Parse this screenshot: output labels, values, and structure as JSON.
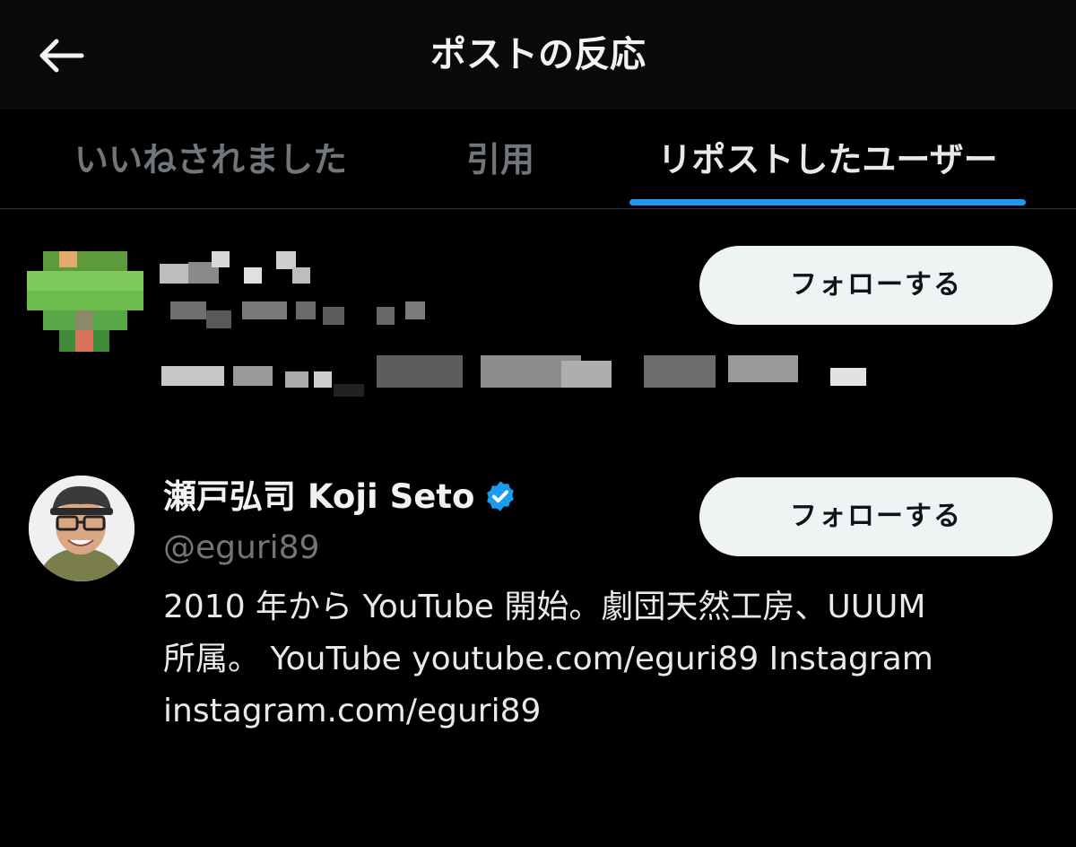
{
  "header": {
    "title": "ポストの反応",
    "back_icon": "arrow-left-icon"
  },
  "tabs": [
    {
      "label": "いいねされました",
      "active": false
    },
    {
      "label": "引用",
      "active": false
    },
    {
      "label": "リポストしたユーザー",
      "active": true
    }
  ],
  "accent_color": "#1d9bf0",
  "users": [
    {
      "display_name": "",
      "handle": "",
      "bio": "",
      "redacted": true,
      "follow_label": "フォローする"
    },
    {
      "display_name": "瀬戸弘司 Koji Seto",
      "verified": true,
      "handle": "@eguri89",
      "bio_lines": [
        "2010 年から YouTube 開始。劇団天然工房、UUUM",
        "所属。 YouTube youtube.com/eguri89 Instagram",
        "instagram.com/eguri89"
      ],
      "follow_label": "フォローする"
    }
  ]
}
